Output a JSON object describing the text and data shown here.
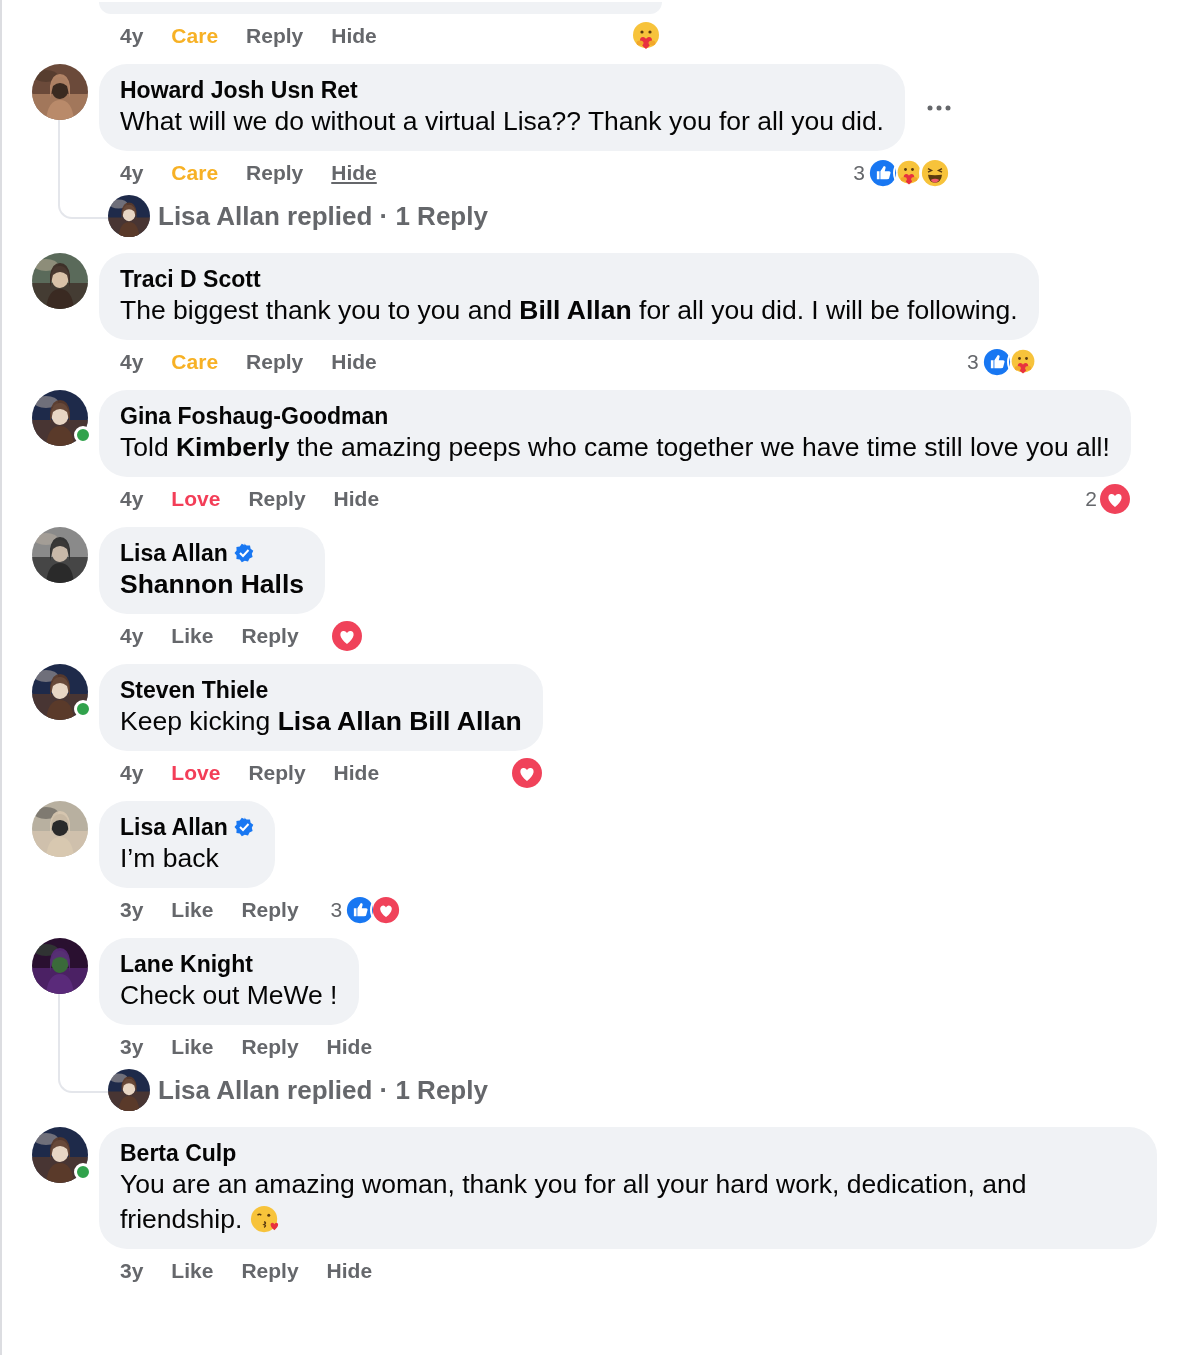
{
  "comments": [
    {
      "kind": "cut",
      "time": "4y",
      "actions": [
        {
          "label": "Care",
          "kind": "care"
        },
        {
          "label": "Reply",
          "kind": "plain"
        },
        {
          "label": "Hide",
          "kind": "plain"
        }
      ],
      "hovered": false,
      "reactions": {
        "emojis": [
          {
            "kind": "care"
          }
        ]
      }
    },
    {
      "kind": "comment",
      "author": "Howard Josh Usn Ret",
      "verified": false,
      "online": false,
      "hovered": true,
      "text": "What will we do without a virtual Lisa?? Thank you for all you did.",
      "time": "4y",
      "actions": [
        {
          "label": "Care",
          "kind": "care"
        },
        {
          "label": "Reply",
          "kind": "plain"
        },
        {
          "label": "Hide",
          "kind": "plain"
        }
      ],
      "reactions": {
        "count": "3",
        "emojis": [
          {
            "kind": "like"
          },
          {
            "kind": "care"
          },
          {
            "kind": "haha"
          }
        ]
      },
      "reply": {
        "text": "Lisa Allan replied · 1 Reply"
      }
    },
    {
      "kind": "comment",
      "author": "Traci D Scott",
      "verified": false,
      "online": false,
      "hovered": false,
      "text": "The biggest thank you to you and **Bill Allan** for all you did. I will be following.",
      "time": "4y",
      "actions": [
        {
          "label": "Care",
          "kind": "care"
        },
        {
          "label": "Reply",
          "kind": "plain"
        },
        {
          "label": "Hide",
          "kind": "plain"
        }
      ],
      "reactions": {
        "count": "3",
        "emojis": [
          {
            "kind": "like"
          },
          {
            "kind": "care"
          }
        ]
      }
    },
    {
      "kind": "comment",
      "author": "Gina Foshaug-Goodman",
      "verified": false,
      "online": true,
      "hovered": false,
      "text": "Told **Kimberly** the amazing peeps who came together we have time still love you all!",
      "time": "4y",
      "actions": [
        {
          "label": "Love",
          "kind": "love"
        },
        {
          "label": "Reply",
          "kind": "plain"
        },
        {
          "label": "Hide",
          "kind": "plain"
        }
      ],
      "reactions": {
        "count": "2",
        "emojis": [
          {
            "kind": "love"
          }
        ]
      }
    },
    {
      "kind": "comment",
      "author": "Lisa Allan",
      "verified": true,
      "online": false,
      "hovered": false,
      "text": "**Shannon Halls**",
      "time": "4y",
      "actions": [
        {
          "label": "Like",
          "kind": "plain"
        },
        {
          "label": "Reply",
          "kind": "plain"
        }
      ],
      "reactions": {
        "emojis": [
          {
            "kind": "love"
          }
        ]
      }
    },
    {
      "kind": "comment",
      "author": "Steven Thiele",
      "verified": false,
      "online": true,
      "hovered": false,
      "text": "Keep kicking **Lisa Allan Bill Allan**",
      "time": "4y",
      "actions": [
        {
          "label": "Love",
          "kind": "love"
        },
        {
          "label": "Reply",
          "kind": "plain"
        },
        {
          "label": "Hide",
          "kind": "plain"
        }
      ],
      "reactions": {
        "emojis": [
          {
            "kind": "love"
          }
        ]
      }
    },
    {
      "kind": "comment",
      "author": "Lisa Allan",
      "verified": true,
      "online": false,
      "hovered": false,
      "text": "I’m back",
      "time": "3y",
      "actions": [
        {
          "label": "Like",
          "kind": "plain"
        },
        {
          "label": "Reply",
          "kind": "plain"
        }
      ],
      "reactions": {
        "count": "3",
        "emojis": [
          {
            "kind": "like"
          },
          {
            "kind": "love"
          }
        ]
      }
    },
    {
      "kind": "comment",
      "author": "Lane Knight",
      "verified": false,
      "online": false,
      "hovered": false,
      "text": "Check out MeWe !",
      "time": "3y",
      "actions": [
        {
          "label": "Like",
          "kind": "plain"
        },
        {
          "label": "Reply",
          "kind": "plain"
        },
        {
          "label": "Hide",
          "kind": "plain"
        }
      ],
      "reply": {
        "text": "Lisa Allan replied · 1 Reply"
      }
    },
    {
      "kind": "comment",
      "author": "Berta Culp",
      "verified": false,
      "online": true,
      "hovered": false,
      "text": "You are an amazing woman, thank you for all your hard work, dedication, and friendship.",
      "trailing_emoji": {
        "kind": "kiss"
      },
      "time": "3y",
      "actions": [
        {
          "label": "Like",
          "kind": "plain"
        },
        {
          "label": "Reply",
          "kind": "plain"
        },
        {
          "label": "Hide",
          "kind": "plain"
        }
      ]
    }
  ]
}
